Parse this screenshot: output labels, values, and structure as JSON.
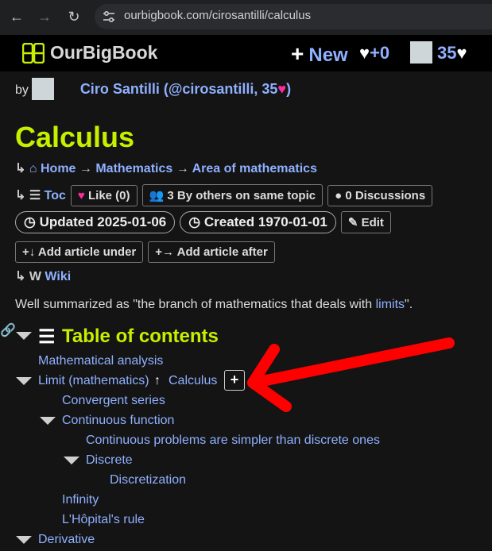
{
  "browser": {
    "url": "ourbigbook.com/cirosantilli/calculus"
  },
  "topbar": {
    "brand": "OurBigBook",
    "new_label": "New",
    "heart_score": "+0",
    "user_score": "35"
  },
  "byline": {
    "by": "by",
    "author": "Ciro Santilli (@cirosantilli, 35",
    "author_end": ")"
  },
  "article": {
    "title": "Calculus",
    "breadcrumbs": [
      "Home",
      "Mathematics",
      "Area of mathematics"
    ],
    "toc_label": "Toc",
    "like_label": "Like (0)",
    "others_label": "3 By others on same topic",
    "discussions_label": "0 Discussions",
    "updated_label": "Updated 2025-01-06",
    "created_label": "Created 1970-01-01",
    "edit_label": "Edit",
    "add_under_label": "Add article under",
    "add_after_label": "Add article after",
    "wiki_label": "Wiki",
    "summary_prefix": "Well summarized as \"the branch of mathematics that deals with ",
    "summary_link": "limits",
    "summary_suffix": "\"."
  },
  "toc": {
    "title": "Table of contents",
    "parent_link": "Calculus",
    "items": [
      {
        "label": "Mathematical analysis"
      },
      {
        "label": "Limit (mathematics)"
      },
      {
        "label": "Convergent series"
      },
      {
        "label": "Continuous function"
      },
      {
        "label": "Continuous problems are simpler than discrete ones"
      },
      {
        "label": "Discrete"
      },
      {
        "label": "Discretization"
      },
      {
        "label": "Infinity"
      },
      {
        "label": "L'Hôpital's rule"
      },
      {
        "label": "Derivative"
      }
    ]
  },
  "colors": {
    "title": "#c6f000",
    "link": "#8fb0ff",
    "annotation_arrow": "#ff0000"
  }
}
